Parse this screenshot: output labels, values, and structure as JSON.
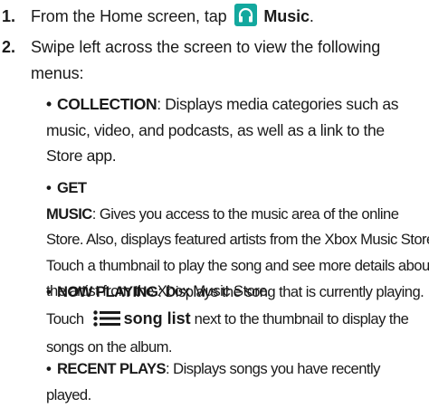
{
  "steps": [
    {
      "number": "1.",
      "before": "From the Home screen, tap",
      "icon": "headphones-icon",
      "bold": "Music",
      "after": "."
    },
    {
      "number": "2.",
      "line1": "Swipe left across the screen to view the following",
      "line2": "menus:"
    }
  ],
  "menus": [
    {
      "title": "COLLECTION",
      "lines": [
        ": Displays media categories such as",
        "music, video, and podcasts, as well as a link to the",
        "Store app."
      ]
    },
    {
      "title": "GET MUSIC",
      "lines": [
        ": Gives you access to the music area of the online",
        "Store. Also, displays featured artists from the Xbox Music Store.",
        "Touch a thumbnail to play the song and see more details about",
        "the artist from the Xbox Music Store."
      ]
    },
    {
      "title": "NOW PLAYING",
      "lines": [
        ": Displays the song that is currently playing.",
        "Touch",
        "song list",
        "next to the thumbnail to display the",
        "songs on the album."
      ],
      "icon": "song-list-icon"
    },
    {
      "title": "RECENT PLAYS",
      "lines": [
        ": Displays songs you have recently played."
      ]
    }
  ],
  "colors": {
    "icon_bg": "#13a89e",
    "text": "#1a1a1a"
  }
}
